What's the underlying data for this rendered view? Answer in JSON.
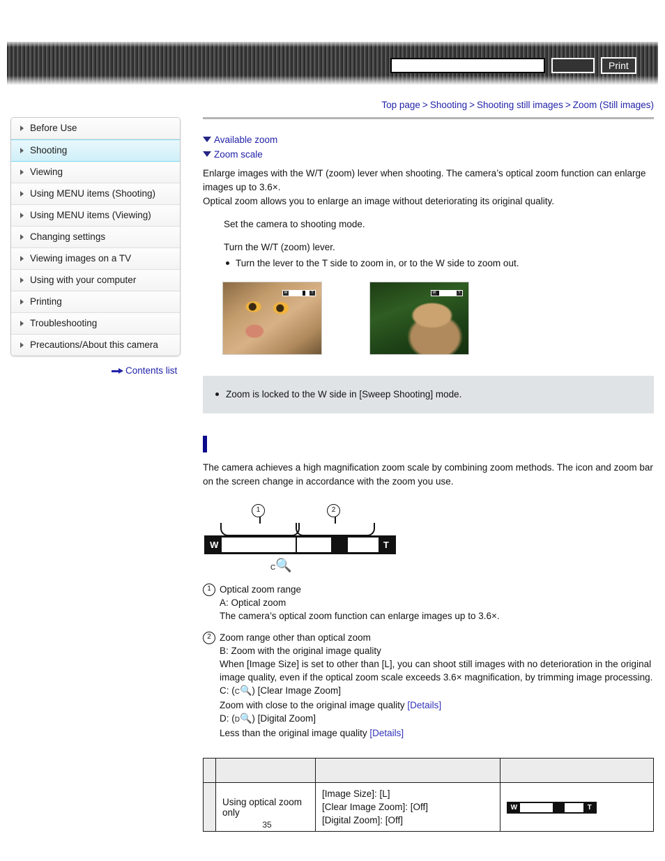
{
  "header": {
    "search_value": "",
    "search_placeholder": "",
    "search_button_label": "",
    "print_button_label": "Print"
  },
  "breadcrumb": {
    "items": [
      "Top page",
      "Shooting",
      "Shooting still images",
      "Zoom (Still images)"
    ],
    "separator": ">"
  },
  "sidebar": {
    "items": [
      {
        "label": "Before Use",
        "selected": false
      },
      {
        "label": "Shooting",
        "selected": true
      },
      {
        "label": "Viewing",
        "selected": false
      },
      {
        "label": "Using MENU items (Shooting)",
        "selected": false
      },
      {
        "label": "Using MENU items (Viewing)",
        "selected": false
      },
      {
        "label": "Changing settings",
        "selected": false
      },
      {
        "label": "Viewing images on a TV",
        "selected": false
      },
      {
        "label": "Using with your computer",
        "selected": false
      },
      {
        "label": "Printing",
        "selected": false
      },
      {
        "label": "Troubleshooting",
        "selected": false
      },
      {
        "label": "Precautions/About this camera",
        "selected": false
      }
    ],
    "contents_list_label": "Contents list"
  },
  "main": {
    "anchors": [
      {
        "label": "Available zoom"
      },
      {
        "label": "Zoom scale"
      }
    ],
    "lead_paragraph_1": "Enlarge images with the W/T (zoom) lever when shooting. The camera’s optical zoom function can enlarge images up to 3.6×.",
    "lead_paragraph_2": "Optical zoom allows you to enlarge an image without deteriorating its original quality.",
    "steps": [
      {
        "text": "Set the camera to shooting mode.",
        "sub": ""
      },
      {
        "text": "Turn the W/T (zoom) lever.",
        "sub": "Turn the lever to the T side to zoom in, or to the W side to zoom out."
      }
    ],
    "photos": [
      {
        "name": "cat-telephoto",
        "zoom_bar": {
          "w_label": "W",
          "t_label": "T"
        }
      },
      {
        "name": "cat-wide",
        "zoom_bar": {
          "w_label": "W",
          "t_label": "T"
        }
      }
    ],
    "note": "Zoom is locked to the W side in [Sweep Shooting] mode.",
    "section_heading": "",
    "section_paragraph": "The camera achieves a high magnification zoom scale by combining zoom methods. The icon and zoom bar on the screen change in accordance with the zoom you use.",
    "diagram": {
      "marker_1": "1",
      "marker_2": "2",
      "w_label": "W",
      "t_label": "T",
      "icon_label_sub": "C",
      "icon_label_glyph": "🔍"
    },
    "definitions": [
      {
        "num": "1",
        "title": "Optical zoom range",
        "lines": [
          {
            "text": "A: Optical zoom"
          },
          {
            "text": "The camera’s optical zoom function can enlarge images up to 3.6×."
          }
        ]
      },
      {
        "num": "2",
        "title": "Zoom range other than optical zoom",
        "lines": [
          {
            "text": "B: Zoom with the original image quality"
          },
          {
            "text": "When [Image Size] is set to other than [L], you can shoot still images with no deterioration in the original image quality, even if the optical zoom scale exceeds 3.6× magnification, by trimming image processing."
          },
          {
            "text_pre": "C: (",
            "icon_sub": "C",
            "text_post": ") [Clear Image Zoom]"
          },
          {
            "text": "Zoom with close to the original image quality ",
            "link": "[Details]"
          },
          {
            "text_pre": "D: (",
            "icon_sub": "D",
            "text_post": ") [Digital Zoom]"
          },
          {
            "text": "Less than the original image quality ",
            "link": "[Details]"
          }
        ]
      }
    ],
    "table": {
      "headers": [
        "",
        "",
        "",
        ""
      ],
      "rows": [
        {
          "col0": "",
          "col1": "Using optical zoom only",
          "col2": [
            "[Image Size]: [L]",
            "[Clear Image Zoom]: [Off]",
            "[Digital Zoom]: [Off]"
          ],
          "col3_zoombar": {
            "w_label": "W",
            "t_label": "T"
          }
        }
      ]
    }
  },
  "footer": {
    "page_number": "35"
  }
}
